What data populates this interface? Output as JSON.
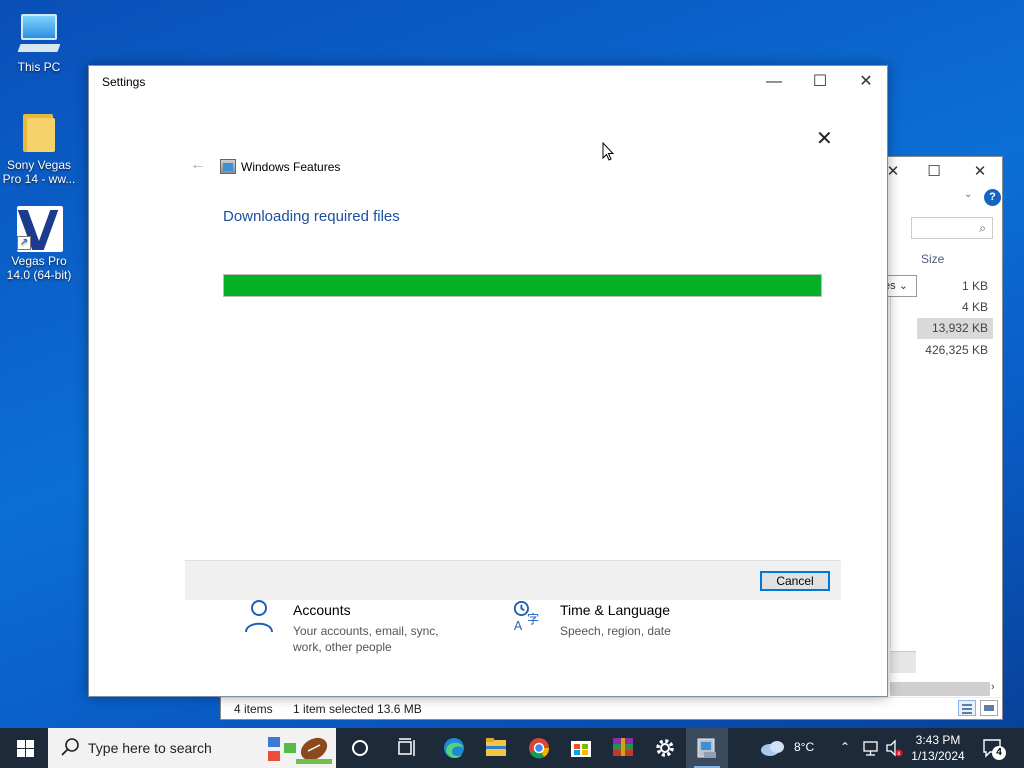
{
  "desktop": {
    "icons": [
      {
        "label": "This PC"
      },
      {
        "label": "Sony Vegas Pro 14 - ww..."
      },
      {
        "label": "Vegas Pro 14.0 (64-bit)"
      }
    ]
  },
  "explorer": {
    "size_header": "Size",
    "combo_text": "es",
    "sizes": [
      "1 KB",
      "4 KB",
      "13,932 KB",
      "426,325 KB"
    ],
    "status": {
      "items": "4 items",
      "selected": "1 item selected  13.6 MB"
    }
  },
  "settings": {
    "title": "Settings",
    "panel_title": "Windows Features",
    "heading": "Downloading required files",
    "progress_fraction": 1.0,
    "cancel_label": "Cancel",
    "categories": [
      {
        "title": "Accounts",
        "desc": "Your accounts, email, sync, work, other people",
        "icon": "person-icon"
      },
      {
        "title": "Time & Language",
        "desc": "Speech, region, date",
        "icon": "time-language-icon"
      }
    ]
  },
  "taskbar": {
    "search_placeholder": "Type here to search",
    "weather_temp": "8°C",
    "time": "3:43 PM",
    "date": "1/13/2024",
    "notifications_count": "4",
    "accent_color": "#06b025"
  }
}
